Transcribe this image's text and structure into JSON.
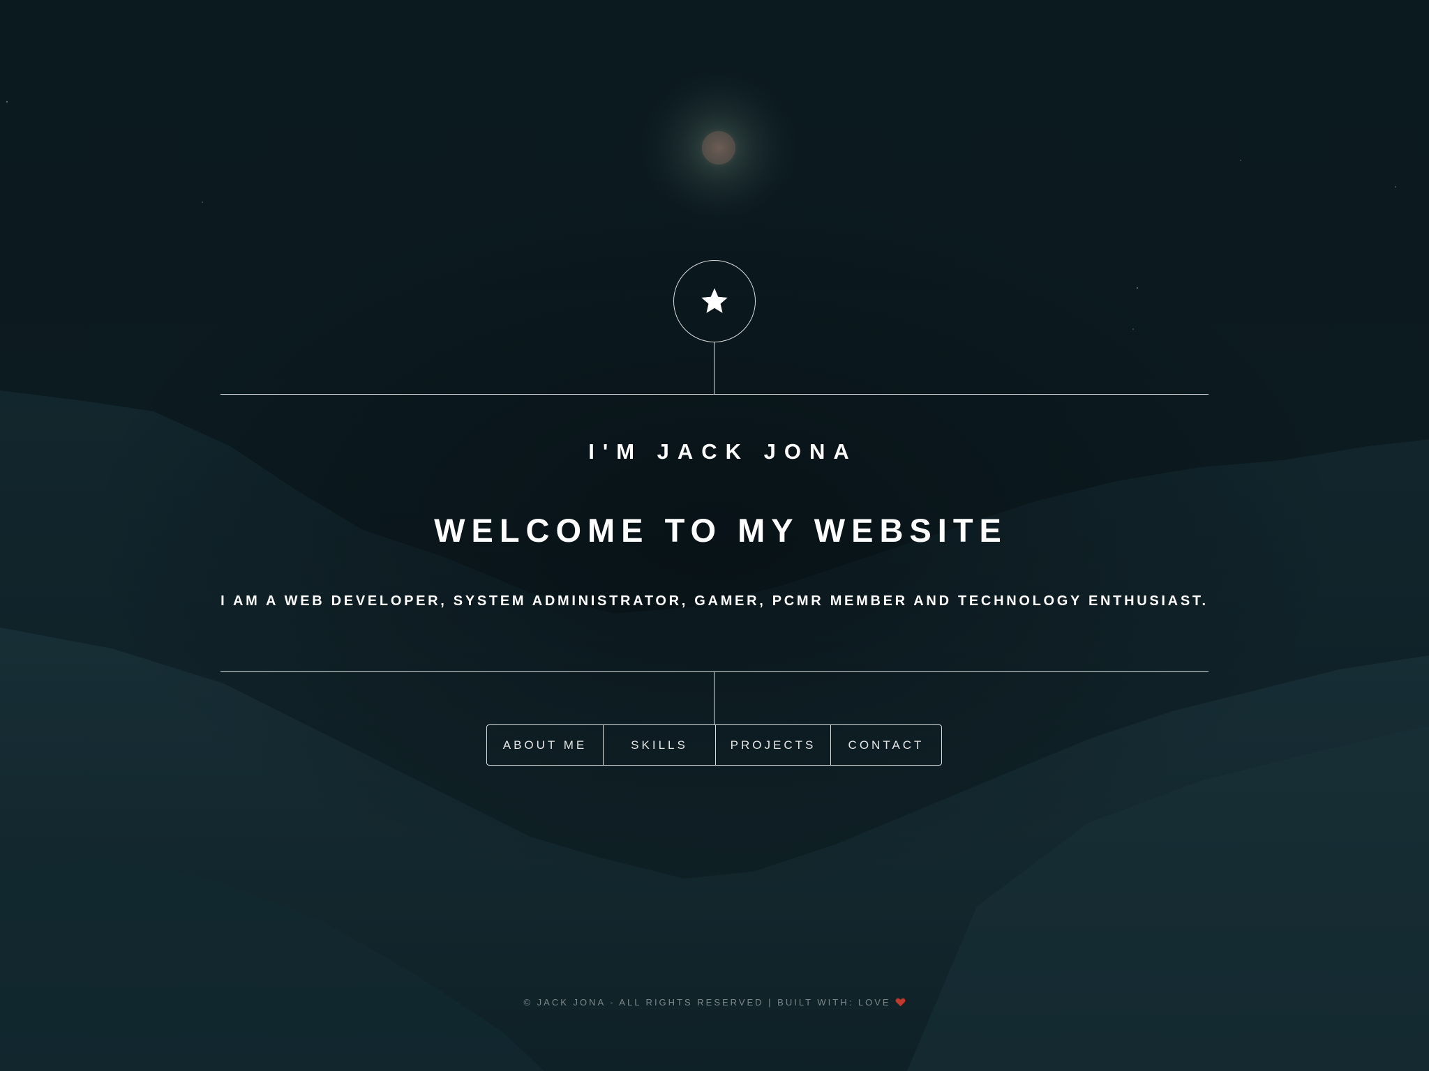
{
  "header": {
    "logo_icon": "star-icon"
  },
  "main": {
    "intro": "I'M JACK JONA",
    "headline": "WELCOME TO MY WEBSITE",
    "description": "I AM A WEB DEVELOPER, SYSTEM ADMINISTRATOR, GAMER, PCMR MEMBER AND TECHNOLOGY ENTHUSIAST."
  },
  "nav": {
    "items": [
      {
        "label": "ABOUT ME"
      },
      {
        "label": "SKILLS"
      },
      {
        "label": "PROJECTS"
      },
      {
        "label": "CONTACT"
      }
    ]
  },
  "footer": {
    "text": "© JACK JONA - ALL RIGHTS RESERVED | BUILT WITH: LOVE",
    "heart_icon": "heart-icon",
    "heart_color": "#c0392b"
  },
  "theme": {
    "background": "#0a1418",
    "line_color": "#ffffff"
  }
}
